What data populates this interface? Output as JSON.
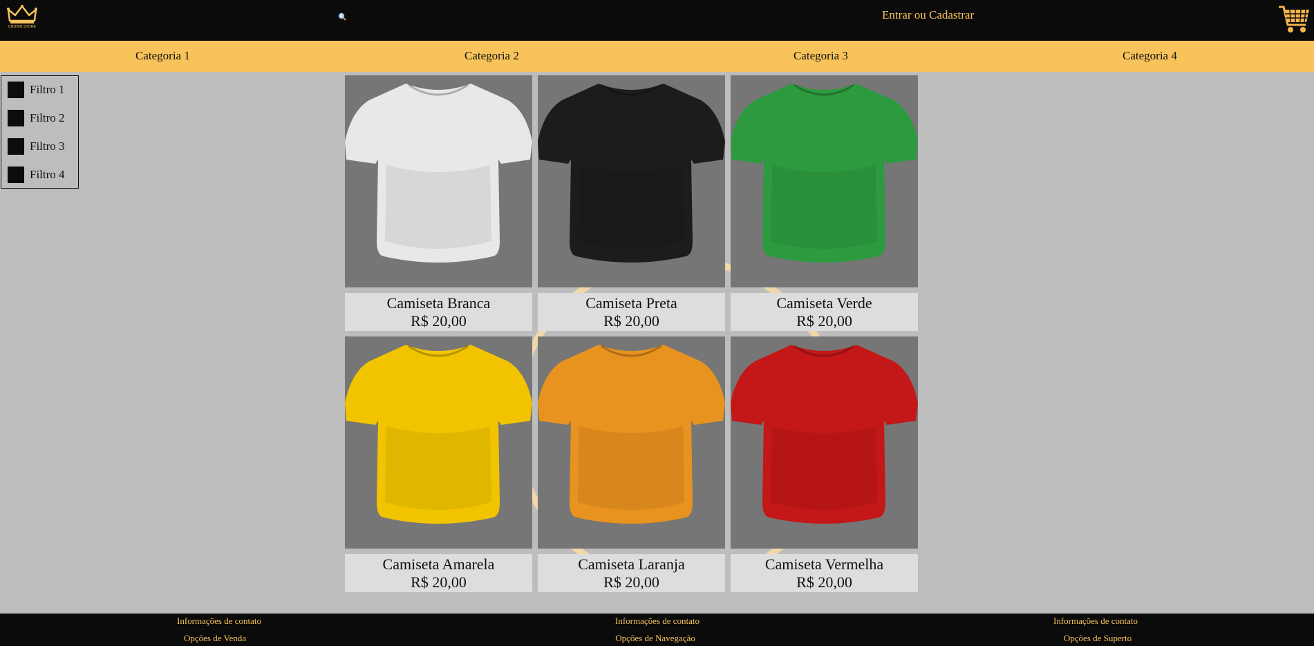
{
  "header": {
    "logo_text": "CROWN STORE",
    "search_icon": "search-icon",
    "login_label": "Entrar ou Cadastrar",
    "cart_icon": "shopping-cart-icon"
  },
  "categories": [
    {
      "label": "Categoria 1"
    },
    {
      "label": "Categoria 2"
    },
    {
      "label": "Categoria 3"
    },
    {
      "label": "Categoria 4"
    }
  ],
  "filters": [
    {
      "label": "Filtro 1"
    },
    {
      "label": "Filtro 2"
    },
    {
      "label": "Filtro 3"
    },
    {
      "label": "Filtro 4"
    }
  ],
  "products": [
    {
      "name": "Camiseta Branca",
      "price": "R$ 20,00",
      "color": "#e8e8e8"
    },
    {
      "name": "Camiseta Preta",
      "price": "R$ 20,00",
      "color": "#1c1c1c"
    },
    {
      "name": "Camiseta Verde",
      "price": "R$ 20,00",
      "color": "#2e9a3f"
    },
    {
      "name": "Camiseta Amarela",
      "price": "R$ 20,00",
      "color": "#f2c400"
    },
    {
      "name": "Camiseta Laranja",
      "price": "R$ 20,00",
      "color": "#e8921f"
    },
    {
      "name": "Camiseta Vermelha",
      "price": "R$ 20,00",
      "color": "#c41717"
    }
  ],
  "footer": {
    "columns": [
      {
        "contact": "Informações de contato",
        "options": "Opções de Venda"
      },
      {
        "contact": "Informações de contato",
        "options": "Opções de Navegação"
      },
      {
        "contact": "Informações de contato",
        "options": "Opções de Superto"
      }
    ]
  },
  "colors": {
    "accent": "#f9c35b",
    "header_bg": "#0b0b0b",
    "page_bg": "#bdbdbd",
    "card_info_bg": "#dddddd",
    "image_bg": "#767676"
  }
}
